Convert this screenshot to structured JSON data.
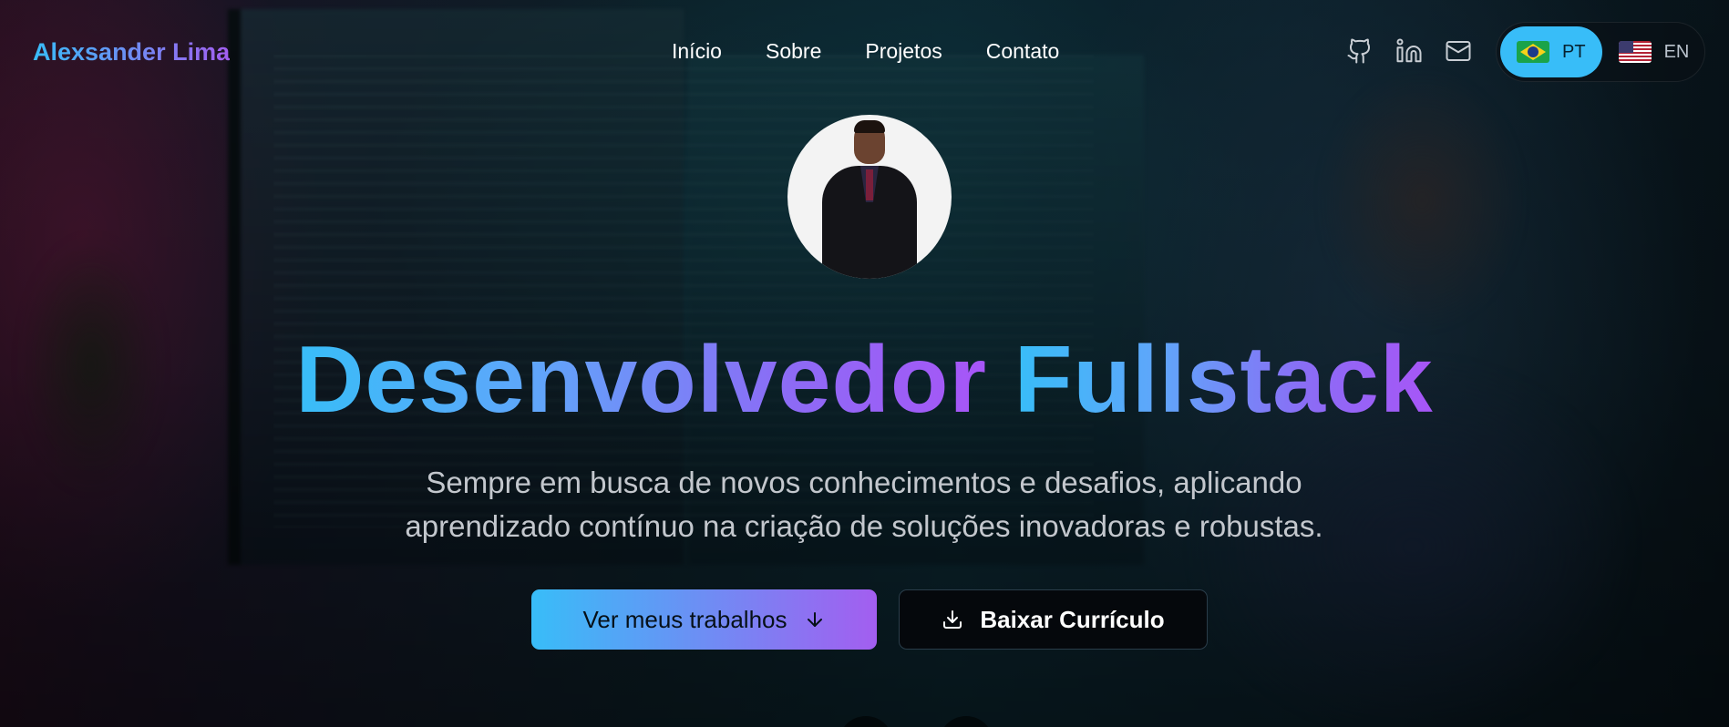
{
  "header": {
    "brand": "Alexsander Lima",
    "nav": [
      {
        "label": "Início"
      },
      {
        "label": "Sobre"
      },
      {
        "label": "Projetos"
      },
      {
        "label": "Contato"
      }
    ],
    "socials": [
      {
        "icon": "github-icon"
      },
      {
        "icon": "linkedin-icon"
      },
      {
        "icon": "mail-icon"
      }
    ],
    "language": {
      "options": [
        {
          "code": "PT",
          "flag": "brazil-flag-icon",
          "active": true
        },
        {
          "code": "EN",
          "flag": "us-flag-icon",
          "active": false
        }
      ]
    }
  },
  "hero": {
    "avatar": "profile-photo",
    "title_part1": "Desenvolvedor",
    "title_part2": "Fullstack",
    "subtitle_line1": "Sempre em busca de novos conhecimentos e desafios, aplicando",
    "subtitle_line2": "aprendizado contínuo na criação de soluções inovadoras e robustas.",
    "primary_button": "Ver meus trabalhos",
    "primary_button_icon": "arrow-down-icon",
    "secondary_button": "Baixar Currículo",
    "secondary_button_icon": "download-icon"
  },
  "colors": {
    "accent_start": "#38bdf8",
    "accent_end": "#a855f7",
    "text_muted": "#c3c7cd"
  }
}
